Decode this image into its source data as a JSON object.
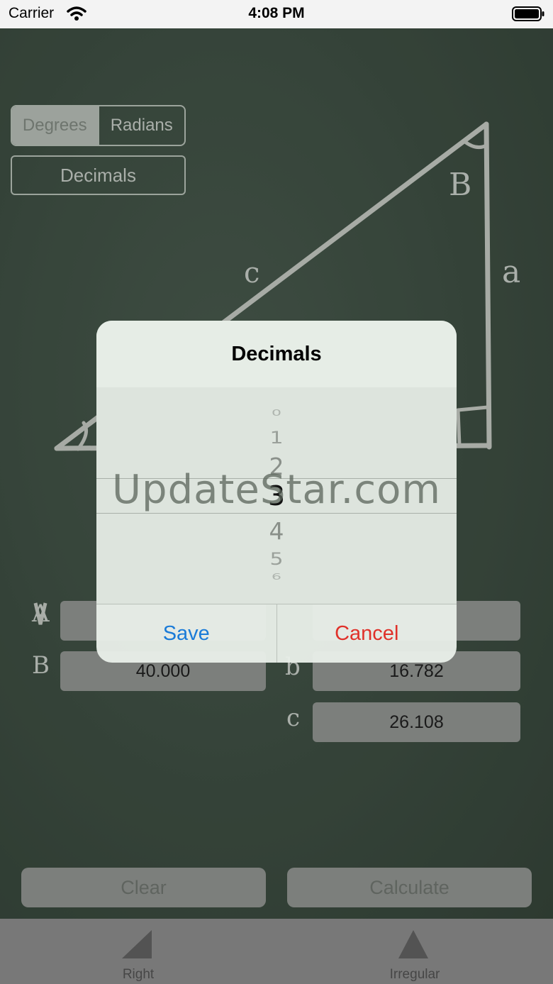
{
  "status_bar": {
    "carrier": "Carrier",
    "time": "4:08 PM"
  },
  "unit_toggle": {
    "options": [
      "Degrees",
      "Radians"
    ],
    "selected": "Degrees"
  },
  "decimals_button": {
    "label": "Decimals"
  },
  "triangle_labels": {
    "angle_b": "B",
    "side_a": "a",
    "side_c": "c"
  },
  "inputs": {
    "A": {
      "label": "A",
      "value": ""
    },
    "B": {
      "label": "B",
      "value": "40.000"
    },
    "a": {
      "label": "a",
      "value": ""
    },
    "b": {
      "label": "b",
      "value": "16.782"
    },
    "c": {
      "label": "c",
      "value": "26.108"
    }
  },
  "buttons": {
    "clear": "Clear",
    "calculate": "Calculate"
  },
  "tabbar": {
    "tabs": [
      {
        "label": "Right",
        "icon": "right-triangle-icon"
      },
      {
        "label": "Irregular",
        "icon": "irregular-triangle-icon"
      }
    ]
  },
  "dialog": {
    "title": "Decimals",
    "picker_values": [
      "0",
      "1",
      "2",
      "3",
      "4",
      "5",
      "6"
    ],
    "selected_value": "3",
    "save": "Save",
    "cancel": "Cancel"
  },
  "watermark": "UpdateStar.com",
  "colors": {
    "save": "#1a7bd8",
    "cancel": "#e0312a",
    "chalkboard": "#334538"
  }
}
